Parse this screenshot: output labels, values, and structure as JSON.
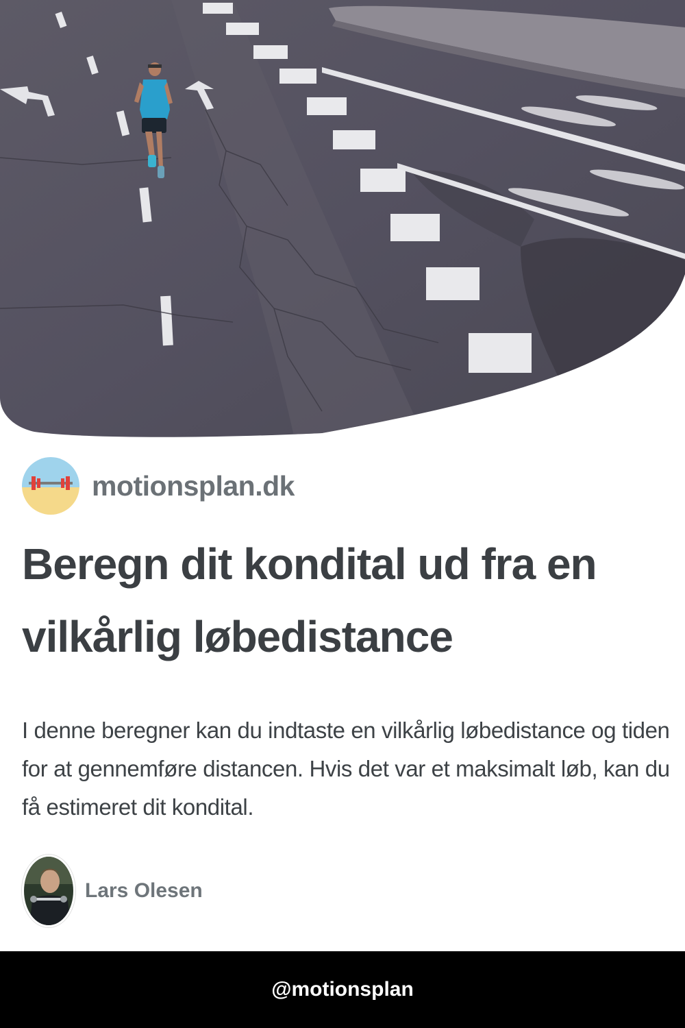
{
  "site": {
    "name": "motionsplan.dk",
    "logo_icon": "barbell-beach-icon"
  },
  "article": {
    "title": "Beregn dit kondital ud fra en vilkårlig løbedistance",
    "description": "I denne beregner kan du indtaste en vilkårlig løbedistance og tiden for at gennemføre distancen. Hvis det var et maksimalt løb, kan du få estimeret dit kondital.",
    "hero_image": "runner-on-asphalt-road-photo"
  },
  "author": {
    "name": "Lars Olesen",
    "avatar": "author-portrait-photo"
  },
  "footer": {
    "handle": "@motionsplan"
  },
  "colors": {
    "background": "#ffffff",
    "footer_background": "#000000",
    "title_text": "#3b3f43",
    "muted_text": "#6b7176",
    "asphalt": "#55525c"
  }
}
